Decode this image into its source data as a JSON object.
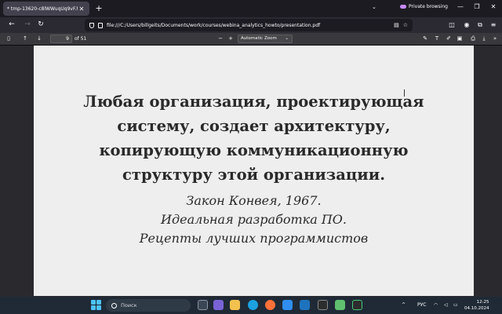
{
  "browser": {
    "tab": {
      "title": "* tmp-13620-c8lWWuqUq9vF.html"
    },
    "private_label": "Private browsing",
    "url": "file:///C:/Users/billgeits/Documents/work/courses/webina_analytics_howto/presentation.pdf"
  },
  "pdf_toolbar": {
    "page_number": "9",
    "page_count_label": "of 51",
    "zoom_label": "Automatic Zoom"
  },
  "slide": {
    "quote_lines": [
      "Любая организация, проектирующая",
      "систему, создает архитектуру,",
      "копирующую коммуникационную",
      "структуру этой организации."
    ],
    "attribution_lines": [
      "Закон Конвея, 1967.",
      "Идеальная разработка ПО.",
      "Рецепты лучших программистов"
    ]
  },
  "taskbar": {
    "search_placeholder": "Поиск",
    "language": "РУС",
    "time": "12:25",
    "date": "04.10.2024"
  },
  "colors": {
    "tab_bg": "#42414d",
    "chrome_bg": "#2b2a33",
    "pdf_toolbar_bg": "#38383d",
    "viewer_bg": "#2a2a2e",
    "slide_bg": "#eeeeee",
    "taskbar_bg": "#1f2a36",
    "private_accent": "#c58af9"
  },
  "icons": {
    "tab_close": "close-icon",
    "new_tab": "plus-icon",
    "back": "arrow-left-icon",
    "forward": "arrow-right-icon",
    "reload": "reload-icon",
    "sidebar": "sidebar-toggle-icon",
    "zoom_out": "minus-icon",
    "zoom_in": "plus-icon"
  }
}
